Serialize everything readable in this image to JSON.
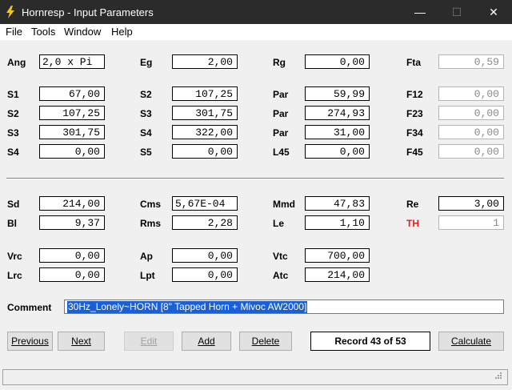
{
  "window": {
    "title": "Hornresp - Input Parameters",
    "minimize": "—",
    "maximize": "☐",
    "close": "✕"
  },
  "menu": [
    "File",
    "Tools",
    "Window",
    "Help"
  ],
  "fields": {
    "ang": {
      "label": "Ang",
      "value": "2,0 x Pi"
    },
    "eg": {
      "label": "Eg",
      "value": "2,00"
    },
    "rg": {
      "label": "Rg",
      "value": "0,00"
    },
    "fta": {
      "label": "Fta",
      "value": "0,59"
    },
    "s1_a": {
      "label": "S1",
      "value": "67,00"
    },
    "s2_a": {
      "label": "S2",
      "value": "107,25"
    },
    "s3_a": {
      "label": "S3",
      "value": "301,75"
    },
    "s4_a": {
      "label": "S4",
      "value": "0,00"
    },
    "s2_b": {
      "label": "S2",
      "value": "107,25"
    },
    "s3_b": {
      "label": "S3",
      "value": "301,75"
    },
    "s4_b": {
      "label": "S4",
      "value": "322,00"
    },
    "s5_b": {
      "label": "S5",
      "value": "0,00"
    },
    "par1": {
      "label": "Par",
      "value": "59,99"
    },
    "par2": {
      "label": "Par",
      "value": "274,93"
    },
    "par3": {
      "label": "Par",
      "value": "31,00"
    },
    "l45": {
      "label": "L45",
      "value": "0,00"
    },
    "f12": {
      "label": "F12",
      "value": "0,00"
    },
    "f23": {
      "label": "F23",
      "value": "0,00"
    },
    "f34": {
      "label": "F34",
      "value": "0,00"
    },
    "f45": {
      "label": "F45",
      "value": "0,00"
    },
    "sd": {
      "label": "Sd",
      "value": "214,00"
    },
    "bl": {
      "label": "Bl",
      "value": "9,37"
    },
    "cms": {
      "label": "Cms",
      "value": "5,67E-04"
    },
    "rms": {
      "label": "Rms",
      "value": "2,28"
    },
    "mmd": {
      "label": "Mmd",
      "value": "47,83"
    },
    "le": {
      "label": "Le",
      "value": "1,10"
    },
    "re": {
      "label": "Re",
      "value": "3,00"
    },
    "th": {
      "label": "TH",
      "value": "1"
    },
    "vrc": {
      "label": "Vrc",
      "value": "0,00"
    },
    "lrc": {
      "label": "Lrc",
      "value": "0,00"
    },
    "ap": {
      "label": "Ap",
      "value": "0,00"
    },
    "lpt": {
      "label": "Lpt",
      "value": "0,00"
    },
    "vtc": {
      "label": "Vtc",
      "value": "700,00"
    },
    "atc": {
      "label": "Atc",
      "value": "214,00"
    }
  },
  "comment": {
    "label": "Comment",
    "value": "30Hz_Lonely~HORN [8\" Tapped Horn + Mivoc AW2000]"
  },
  "buttons": {
    "previous": "Previous",
    "next": "Next",
    "edit": "Edit",
    "add": "Add",
    "delete": "Delete",
    "calculate": "Calculate"
  },
  "record": "Record 43 of 53",
  "colors": {
    "titlebar": "#2b2b2b",
    "th_label": "#e02020",
    "selection": "#1a5fd6",
    "app_icon": "#f5c800"
  }
}
